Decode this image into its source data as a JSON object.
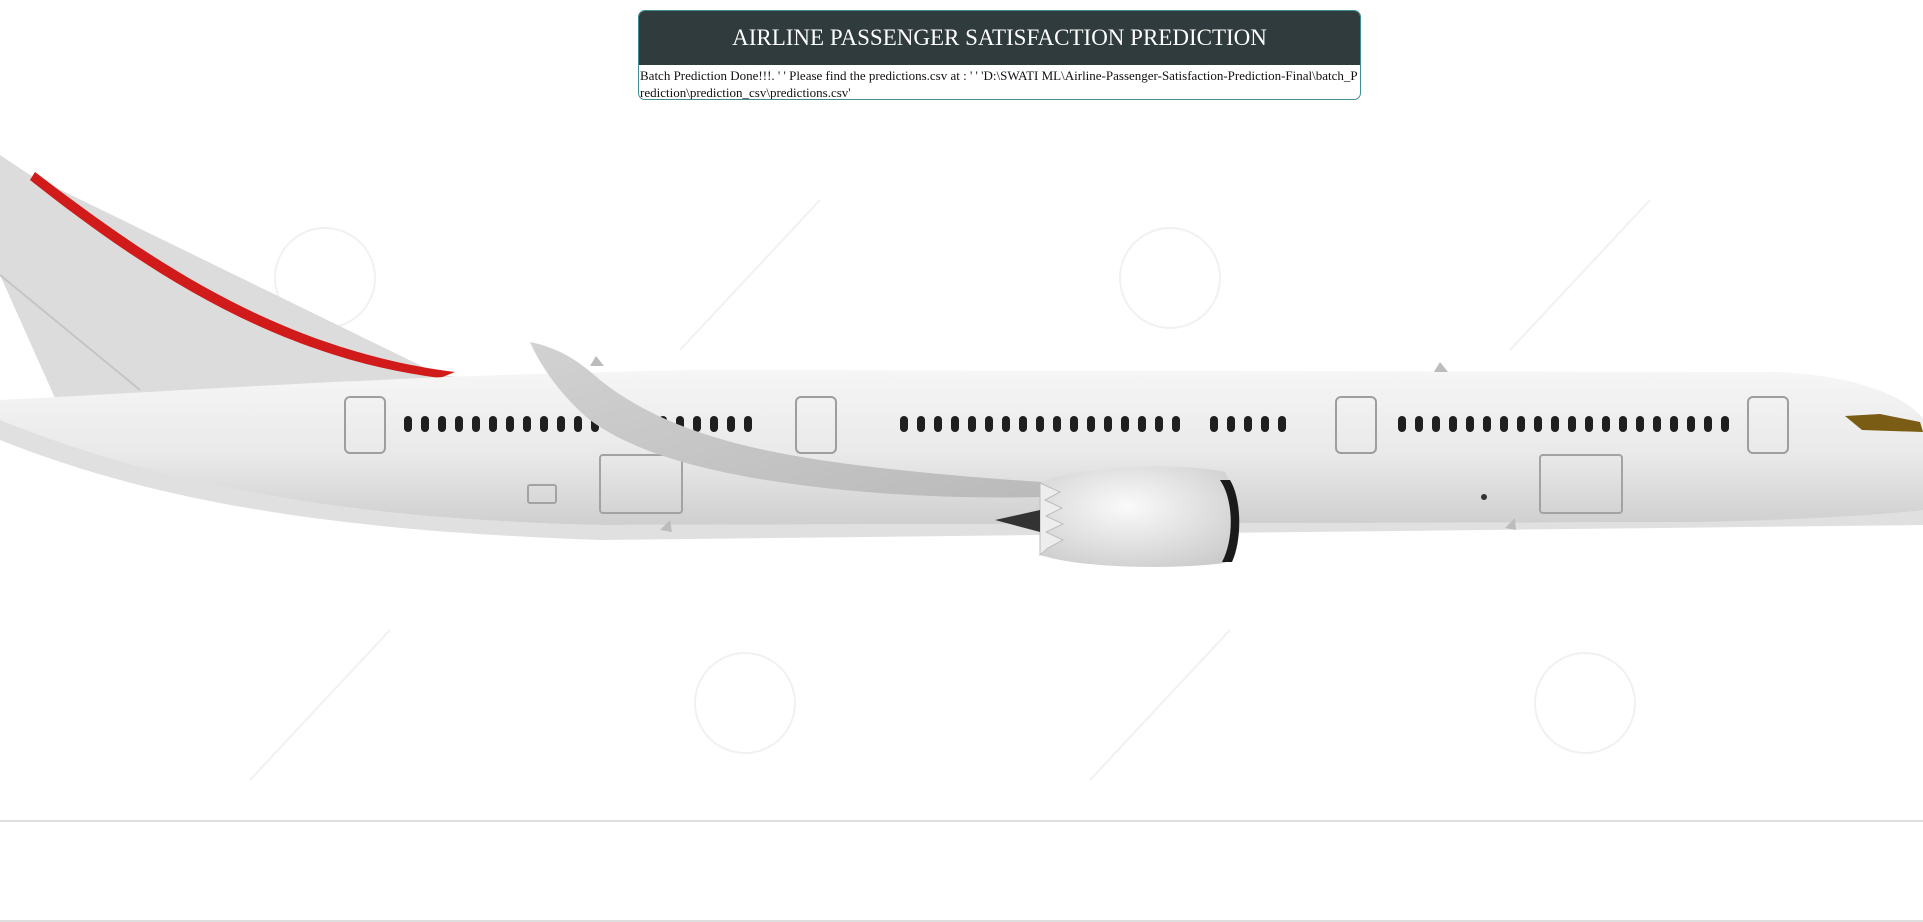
{
  "card": {
    "title": "AIRLINE PASSENGER SATISFACTION PREDICTION",
    "message": "Batch Prediction Done!!!. ' ' Please find the predictions.csv at : ' ' 'D:\\SWATI ML\\Airline-Passenger-Satisfaction-Prediction-Final\\batch_Prediction\\prediction_csv\\predictions.csv'"
  },
  "background": {
    "subject": "airplane-image",
    "colors": {
      "fuselage": "#e8e8e8",
      "tail_stripe": "#d11a1a",
      "window": "#1f1f1f",
      "cockpit": "#7a5c14"
    }
  },
  "theme": {
    "header_bg": "#2f3b3c",
    "border": "#3d8f95"
  }
}
